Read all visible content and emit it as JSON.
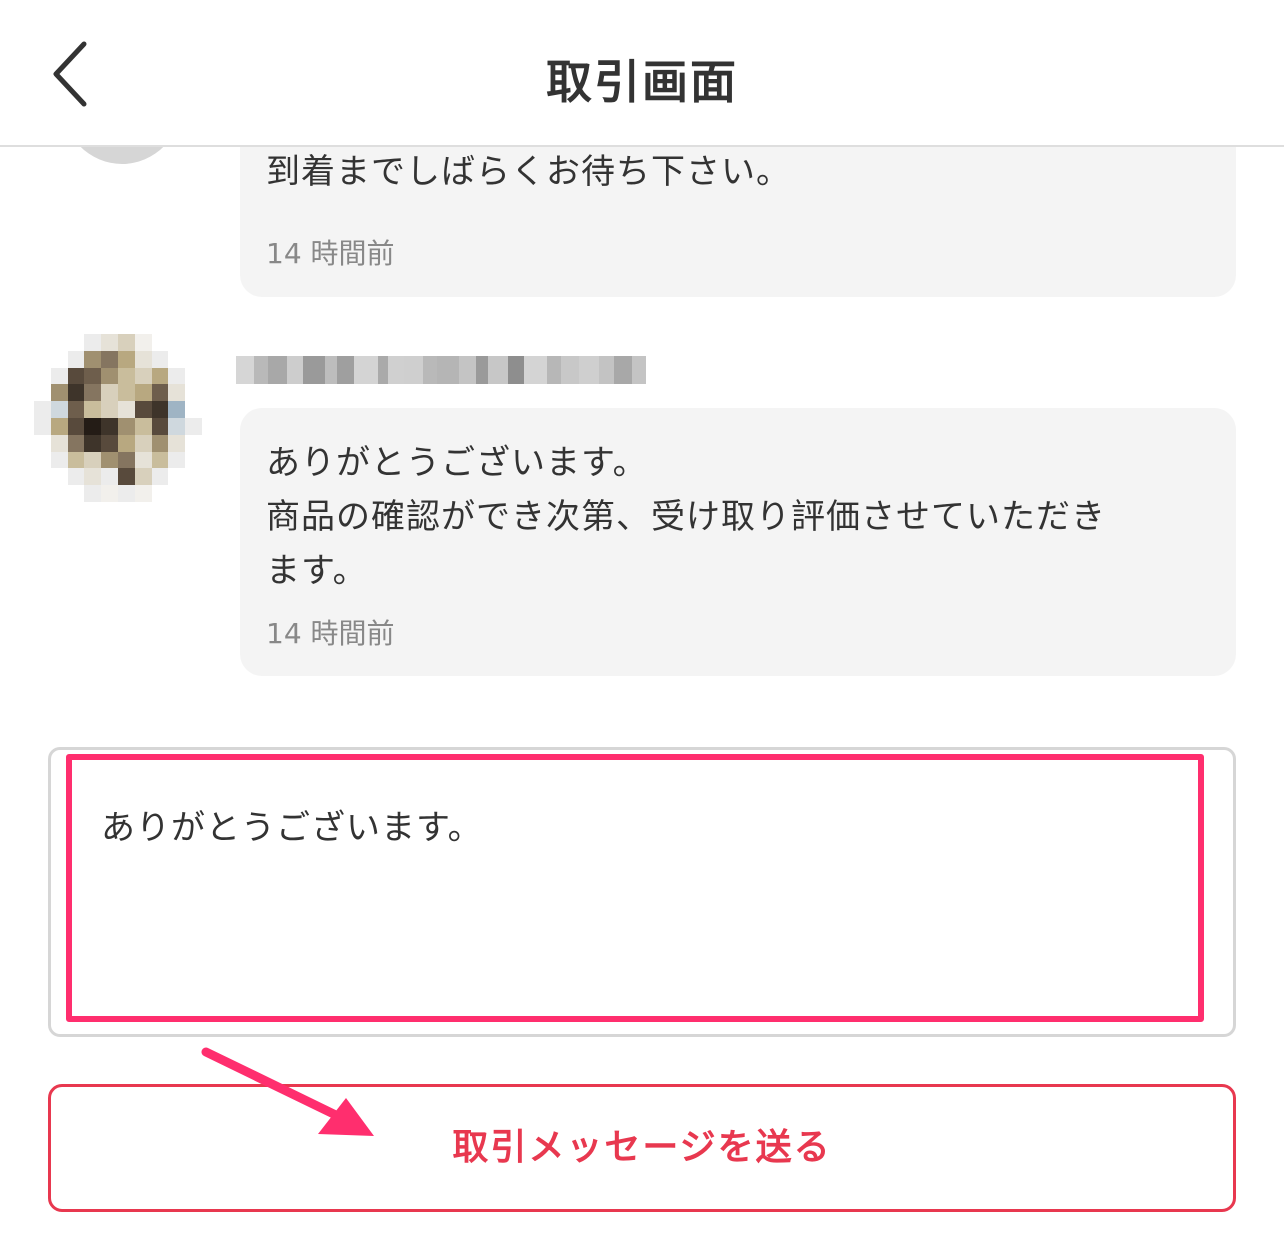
{
  "header": {
    "title": "取引画面",
    "back_icon": "chevron-left-icon"
  },
  "messages": [
    {
      "text": "到着までしばらくお待ち下さい。",
      "time": "14 時間前"
    },
    {
      "text": "ありがとうございます。\n商品の確認ができ次第、受け取り評価させていただき\nます。",
      "time": "14 時間前"
    }
  ],
  "compose": {
    "value": "ありがとうございます。"
  },
  "send_button": {
    "label": "取引メッセージを送る"
  },
  "colors": {
    "accent": "#e8384f",
    "highlight": "#ff2e6e",
    "bubble": "#f4f4f4"
  }
}
